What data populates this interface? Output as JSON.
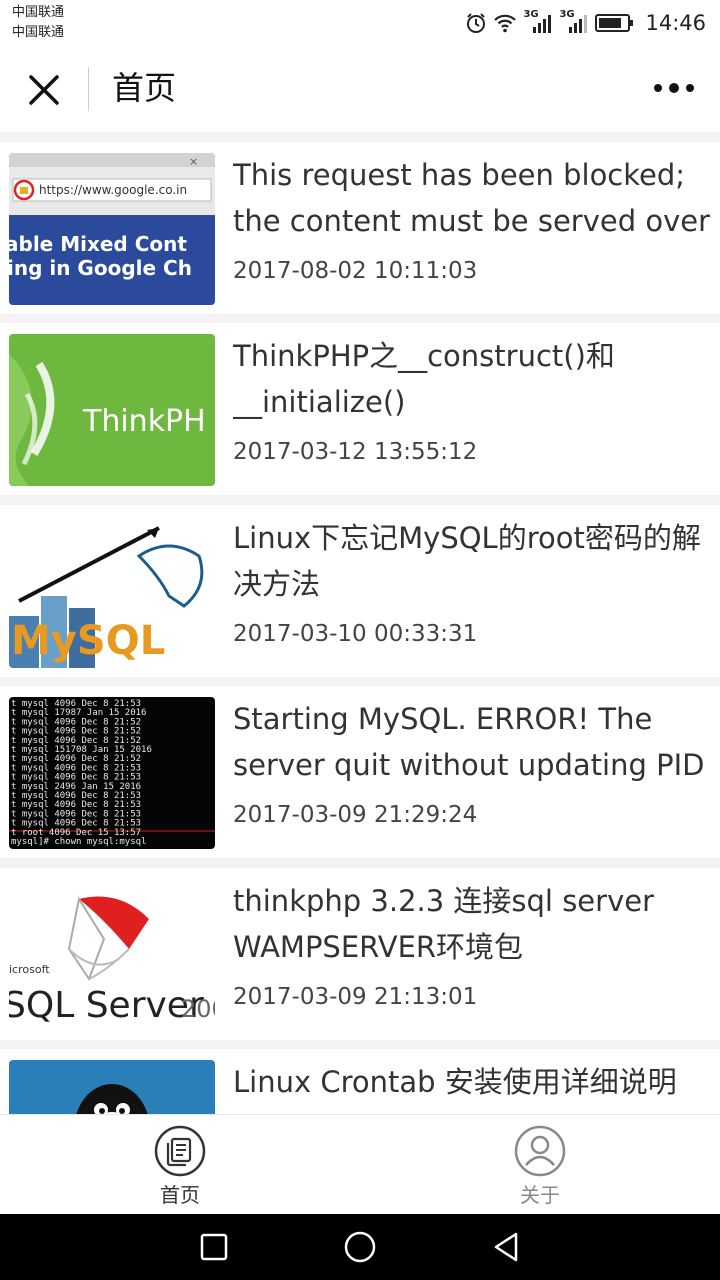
{
  "status_bar": {
    "carrier_1": "中国联通",
    "carrier_2": "中国联通",
    "network_1": "3G",
    "network_2": "3G",
    "time": "14:46"
  },
  "nav": {
    "title": "首页",
    "close_icon": "close-icon",
    "more_icon": "more-icon"
  },
  "articles": [
    {
      "title": "This request has been blocked; the content must be served over",
      "date": "2017-08-02 10:11:03",
      "thumb_text": "https://www.google.co.in",
      "thumb_caption_1": "able Mixed Cont",
      "thumb_caption_2": "ing in Google Ch"
    },
    {
      "title": "ThinkPHP之__construct()和__initialize()",
      "date": "2017-03-12 13:55:12",
      "thumb_text": "ThinkPH"
    },
    {
      "title": "Linux下忘记MySQL的root密码的解决方法",
      "date": "2017-03-10 00:33:31",
      "thumb_text": "MySQL"
    },
    {
      "title": "Starting MySQL. ERROR! The server quit without updating PID",
      "date": "2017-03-09 21:29:24",
      "thumb_lines": [
        "t mysql    4096 Dec  8 21:53",
        "t mysql   17987 Jan 15  2016",
        "t mysql    4096 Dec  8 21:52",
        "t mysql    4096 Dec  8 21:52",
        "t mysql    4096 Dec  8 21:52",
        "t mysql  151708 Jan 15  2016",
        "t mysql    4096 Dec  8 21:52",
        "t mysql    4096 Dec  8 21:53",
        "t mysql    4096 Dec  8 21:53",
        "t mysql    2496 Jan 15  2016",
        "t mysql    4096 Dec  8 21:53",
        "t mysql    4096 Dec  8 21:53",
        "t mysql    4096 Dec  8 21:53",
        "t mysql    4096 Dec  8 21:53",
        "t root     4096 Dec 15 13:57",
        "mysql]# chown mysql:mysql"
      ]
    },
    {
      "title": "thinkphp 3.2.3 连接sql server WAMPSERVER环境包",
      "date": "2017-03-09 21:13:01",
      "thumb_text_1": "icrosoft",
      "thumb_text_2": "SQL Server",
      "thumb_text_3": "200"
    },
    {
      "title": "Linux Crontab 安装使用详细说明",
      "date": ""
    }
  ],
  "tabbar": {
    "home_label": "首页",
    "about_label": "关于",
    "home_icon": "document-icon",
    "about_icon": "user-icon",
    "active_color": "#333333",
    "inactive_color": "#888888"
  },
  "system_nav": {
    "recent_icon": "square-icon",
    "home_icon": "circle-icon",
    "back_icon": "triangle-back-icon"
  }
}
